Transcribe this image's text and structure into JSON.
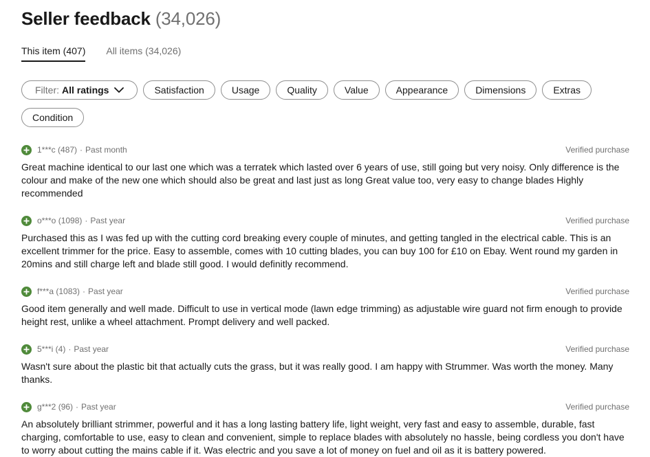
{
  "header": {
    "title": "Seller feedback",
    "count": "(34,026)"
  },
  "tabs": [
    {
      "label": "This item (407)",
      "active": true
    },
    {
      "label": "All items (34,026)",
      "active": false
    }
  ],
  "filter": {
    "prefix": "Filter:",
    "value": "All ratings"
  },
  "chips": [
    "Satisfaction",
    "Usage",
    "Quality",
    "Value",
    "Appearance",
    "Dimensions",
    "Extras",
    "Condition"
  ],
  "reviews": [
    {
      "user": "1***c (487)",
      "time": "Past month",
      "verified": "Verified purchase",
      "text": "Great machine identical to our last one which was a terratek which lasted over 6 years of use, still going but very noisy. Only difference is the colour and make of the new one which should also be great and last just as long Great value too, very easy to change blades Highly recommended"
    },
    {
      "user": "o***o (1098)",
      "time": "Past year",
      "verified": "Verified purchase",
      "text": "Purchased this as I was fed up with the cutting cord breaking every couple of minutes, and getting tangled in the electrical cable. This is an excellent trimmer for the price. Easy to assemble, comes with 10 cutting blades, you can buy 100 for £10 on Ebay. Went round my garden in 20mins and still charge left and blade still good. I would definitly recommend."
    },
    {
      "user": "f***a (1083)",
      "time": "Past year",
      "verified": "Verified purchase",
      "text": "Good item generally and well made. Difficult to use in vertical mode (lawn edge trimming) as adjustable wire guard not firm enough to provide height rest, unlike a wheel attachment. Prompt delivery and well packed."
    },
    {
      "user": "5***i (4)",
      "time": "Past year",
      "verified": "Verified purchase",
      "text": "Wasn't sure about the plastic bit that actually cuts the grass, but it was really good. I am happy with Strummer. Was worth the money. Many thanks."
    },
    {
      "user": "g***2 (96)",
      "time": "Past year",
      "verified": "Verified purchase",
      "text": "An absolutely brilliant strimmer, powerful and it has a long lasting battery life, light weight, very fast and easy to assemble, durable, fast charging, comfortable to use, easy to clean and convenient, simple to replace blades with absolutely no hassle, being cordless you don't have to worry about cutting the mains cable if it. Was electric and you save a lot of money on fuel and oil as it is battery powered."
    }
  ],
  "colors": {
    "positive": "#4f8a3a",
    "text": "#191919",
    "muted": "#707070",
    "border": "#8f8f8f"
  },
  "icons": {
    "positive_rating": "plus-circle-icon",
    "dropdown": "chevron-down-icon"
  }
}
